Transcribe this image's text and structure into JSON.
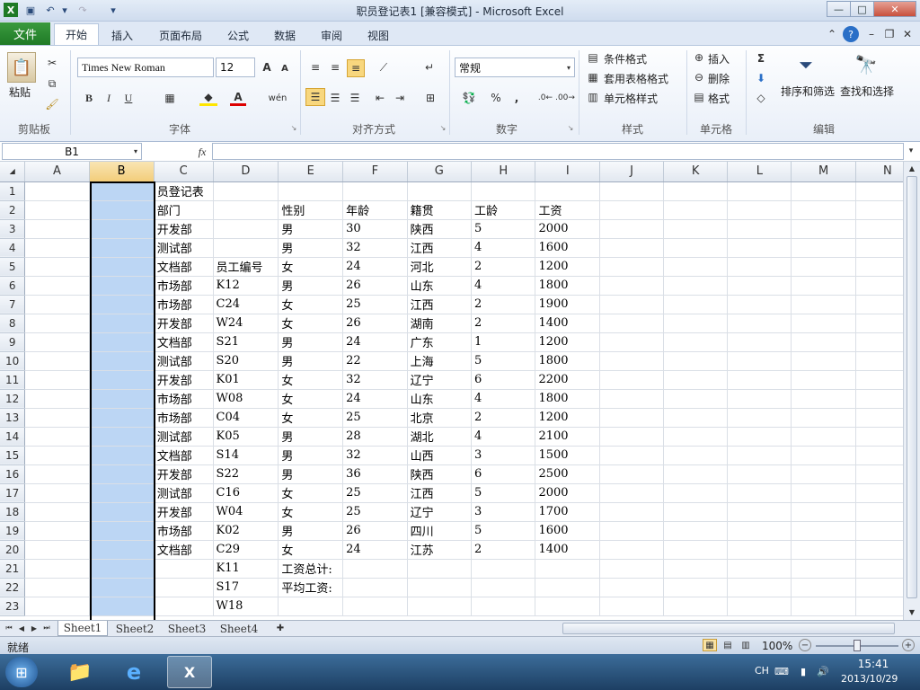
{
  "window": {
    "title": "职员登记表1  [兼容模式]  -  Microsoft Excel",
    "min": "—",
    "max": "□",
    "close": "✕"
  },
  "ribbon_tabs": [
    "文件",
    "开始",
    "插入",
    "页面布局",
    "公式",
    "数据",
    "审阅",
    "视图"
  ],
  "clipboard": {
    "paste": "粘贴",
    "label": "剪贴板"
  },
  "font": {
    "name": "Times New Roman",
    "size": "12",
    "label": "字体",
    "bold": "B",
    "italic": "I",
    "underline": "U"
  },
  "align": {
    "label": "对齐方式"
  },
  "number": {
    "format": "常规",
    "label": "数字",
    "percent": "%",
    "comma": ","
  },
  "styles": {
    "cond": "条件格式",
    "table": "套用表格格式",
    "cell": "单元格样式",
    "label": "样式"
  },
  "cells": {
    "insert": "插入",
    "delete": "删除",
    "format": "格式",
    "label": "单元格"
  },
  "editing": {
    "sigma": "Σ",
    "sort": "排序和筛选",
    "find": "查找和选择",
    "label": "编辑"
  },
  "formula_bar": {
    "name_box": "B1",
    "fx": "fx",
    "value": ""
  },
  "sheet": {
    "columns": [
      "A",
      "B",
      "C",
      "D",
      "E",
      "F",
      "G",
      "H",
      "I",
      "J",
      "K",
      "L",
      "M",
      "N"
    ],
    "selected_column": "B",
    "rows": [
      [
        "",
        "",
        "员登记表",
        "",
        "",
        "",
        "",
        "",
        "",
        "",
        "",
        "",
        "",
        ""
      ],
      [
        "",
        "",
        "部门",
        "",
        "性别",
        "年龄",
        "籍贯",
        "工龄",
        "工资",
        "",
        "",
        "",
        "",
        ""
      ],
      [
        "",
        "",
        "开发部",
        "",
        "男",
        "30",
        "陕西",
        "5",
        "2000",
        "",
        "",
        "",
        "",
        ""
      ],
      [
        "",
        "",
        "测试部",
        "",
        "男",
        "32",
        "江西",
        "4",
        "1600",
        "",
        "",
        "",
        "",
        ""
      ],
      [
        "",
        "",
        "文档部",
        "员工编号",
        "女",
        "24",
        "河北",
        "2",
        "1200",
        "",
        "",
        "",
        "",
        ""
      ],
      [
        "",
        "",
        "市场部",
        "K12",
        "男",
        "26",
        "山东",
        "4",
        "1800",
        "",
        "",
        "",
        "",
        ""
      ],
      [
        "",
        "",
        "市场部",
        "C24",
        "女",
        "25",
        "江西",
        "2",
        "1900",
        "",
        "",
        "",
        "",
        ""
      ],
      [
        "",
        "",
        "开发部",
        "W24",
        "女",
        "26",
        "湖南",
        "2",
        "1400",
        "",
        "",
        "",
        "",
        ""
      ],
      [
        "",
        "",
        "文档部",
        "S21",
        "男",
        "24",
        "广东",
        "1",
        "1200",
        "",
        "",
        "",
        "",
        ""
      ],
      [
        "",
        "",
        "测试部",
        "S20",
        "男",
        "22",
        "上海",
        "5",
        "1800",
        "",
        "",
        "",
        "",
        ""
      ],
      [
        "",
        "",
        "开发部",
        "K01",
        "女",
        "32",
        "辽宁",
        "6",
        "2200",
        "",
        "",
        "",
        "",
        ""
      ],
      [
        "",
        "",
        "市场部",
        "W08",
        "女",
        "24",
        "山东",
        "4",
        "1800",
        "",
        "",
        "",
        "",
        ""
      ],
      [
        "",
        "",
        "市场部",
        "C04",
        "女",
        "25",
        "北京",
        "2",
        "1200",
        "",
        "",
        "",
        "",
        ""
      ],
      [
        "",
        "",
        "测试部",
        "K05",
        "男",
        "28",
        "湖北",
        "4",
        "2100",
        "",
        "",
        "",
        "",
        ""
      ],
      [
        "",
        "",
        "文档部",
        "S14",
        "男",
        "32",
        "山西",
        "3",
        "1500",
        "",
        "",
        "",
        "",
        ""
      ],
      [
        "",
        "",
        "开发部",
        "S22",
        "男",
        "36",
        "陕西",
        "6",
        "2500",
        "",
        "",
        "",
        "",
        ""
      ],
      [
        "",
        "",
        "测试部",
        "C16",
        "女",
        "25",
        "江西",
        "5",
        "2000",
        "",
        "",
        "",
        "",
        ""
      ],
      [
        "",
        "",
        "开发部",
        "W04",
        "女",
        "25",
        "辽宁",
        "3",
        "1700",
        "",
        "",
        "",
        "",
        ""
      ],
      [
        "",
        "",
        "市场部",
        "K02",
        "男",
        "26",
        "四川",
        "5",
        "1600",
        "",
        "",
        "",
        "",
        ""
      ],
      [
        "",
        "",
        "文档部",
        "C29",
        "女",
        "24",
        "江苏",
        "2",
        "1400",
        "",
        "",
        "",
        "",
        ""
      ],
      [
        "",
        "",
        "",
        "K11",
        "工资总计:",
        "",
        "",
        "",
        "",
        "",
        "",
        "",
        "",
        ""
      ],
      [
        "",
        "",
        "",
        "S17",
        "平均工资:",
        "",
        "",
        "",
        "",
        "",
        "",
        "",
        "",
        ""
      ],
      [
        "",
        "",
        "",
        "W18",
        "",
        "",
        "",
        "",
        "",
        "",
        "",
        "",
        "",
        ""
      ]
    ]
  },
  "sheet_tabs": [
    "Sheet1",
    "Sheet2",
    "Sheet3",
    "Sheet4"
  ],
  "status": {
    "ready": "就绪",
    "zoom": "100%"
  },
  "taskbar": {
    "lang": "CH",
    "time": "15:41",
    "date": "2013/10/29"
  }
}
